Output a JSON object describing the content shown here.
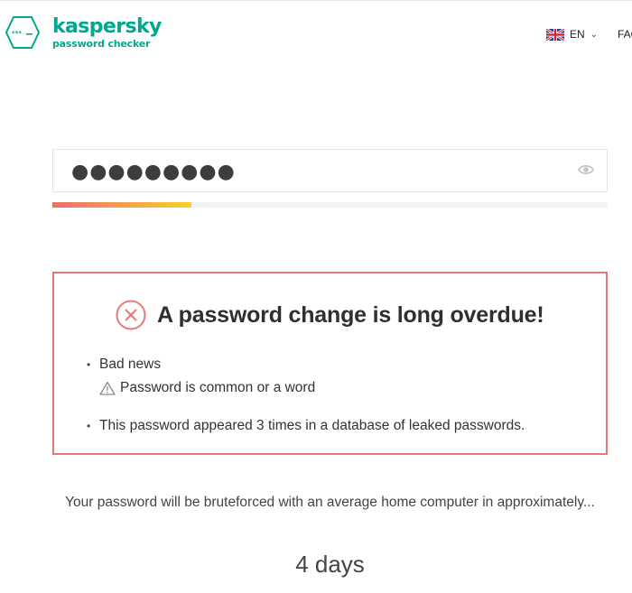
{
  "header": {
    "brand_name": "kaspersky",
    "brand_sub": "password checker",
    "language": "EN",
    "faq_label": "FAQ"
  },
  "password": {
    "masked_value": "●●●●●●●●●",
    "strength_fraction": 0.25
  },
  "result": {
    "title": "A password change is long overdue!",
    "items": [
      {
        "label": "Bad news",
        "detail": "Password is common or a word"
      },
      {
        "label": "This password appeared 3 times in a database of leaked passwords."
      }
    ]
  },
  "bruteforce": {
    "text": "Your password will be bruteforced with an average home computer in approximately...",
    "time": "4 days"
  },
  "colors": {
    "brand": "#00a88e",
    "danger": "#e7787a"
  }
}
